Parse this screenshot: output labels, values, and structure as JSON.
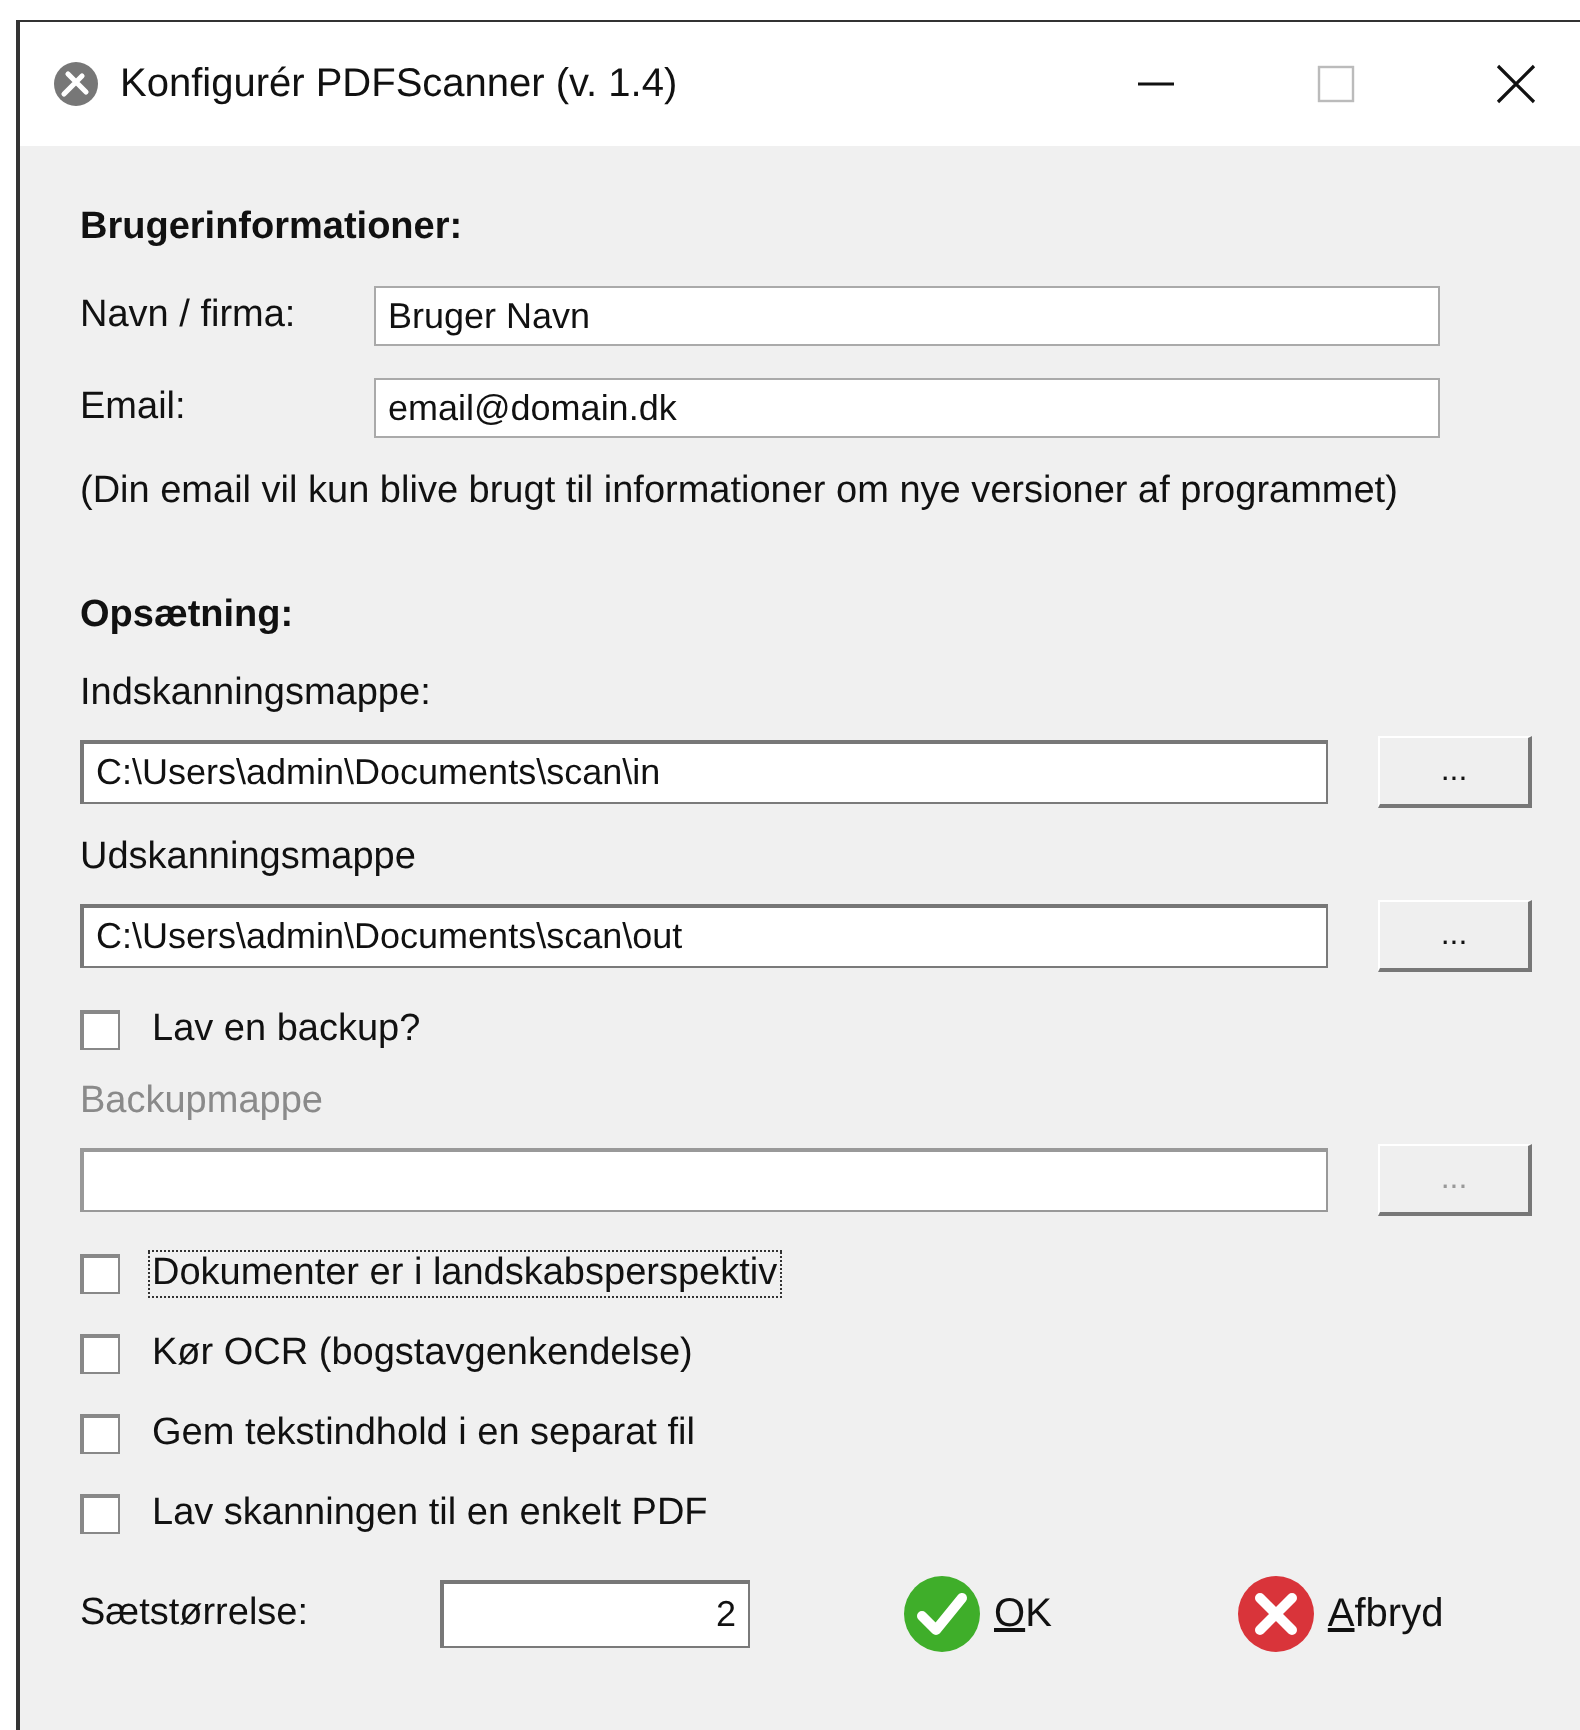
{
  "window": {
    "title": "Konfigurér PDFScanner (v. 1.4)"
  },
  "user_info": {
    "heading": "Brugerinformationer:",
    "fields": [
      {
        "label": "Navn / firma:",
        "value": "Bruger Navn"
      },
      {
        "label": "Email:",
        "value": "email@domain.dk"
      }
    ],
    "note": "(Din email vil kun blive brugt til informationer om nye versioner af programmet)"
  },
  "setup": {
    "heading": "Opsætning:",
    "items": [
      {
        "kind": "folder",
        "label": "Indskanningsmappe:",
        "value": "C:\\Users\\admin\\Documents\\scan\\in",
        "button": "...",
        "disabled": false
      },
      {
        "kind": "folder",
        "label": "Udskanningsmappe",
        "value": "C:\\Users\\admin\\Documents\\scan\\out",
        "button": "...",
        "disabled": false
      },
      {
        "kind": "checkbox",
        "label": "Lav en backup?",
        "checked": false,
        "focused": false
      },
      {
        "kind": "folder",
        "label": "Backupmappe",
        "value": "",
        "button": "...",
        "disabled": true
      },
      {
        "kind": "checkbox",
        "label": "Dokumenter er i landskabsperspektiv",
        "checked": false,
        "focused": true
      },
      {
        "kind": "checkbox",
        "label": "Kør OCR (bogstavgenkendelse)",
        "checked": false,
        "focused": false
      },
      {
        "kind": "checkbox",
        "label": "Gem tekstindhold i en separat fil",
        "checked": false,
        "focused": false
      },
      {
        "kind": "checkbox",
        "label": "Lav skanningen til en enkelt PDF",
        "checked": false,
        "focused": false
      }
    ]
  },
  "batch_size": {
    "label": "Sætstørrelse:",
    "value": "2"
  },
  "buttons": [
    {
      "kind": "ok",
      "label": "OK"
    },
    {
      "kind": "cancel",
      "label": "Afbryd"
    }
  ]
}
